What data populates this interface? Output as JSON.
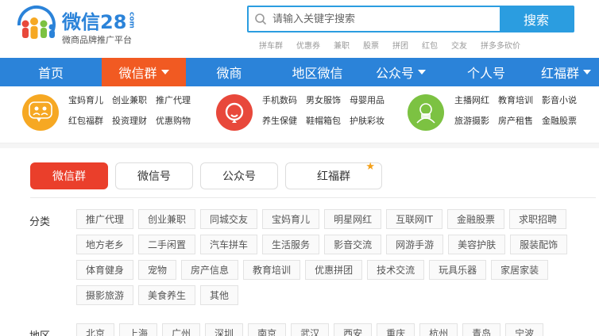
{
  "logo": {
    "name": "微信28",
    "suffix": "com",
    "tagline": "微商品牌推广平台",
    "color": "#2b83d9"
  },
  "search": {
    "placeholder": "请输入关键字搜索",
    "button_label": "搜索",
    "hotwords": [
      "拼车群",
      "优惠券",
      "兼职",
      "股票",
      "拼团",
      "红包",
      "交友",
      "拼多多砍价"
    ]
  },
  "nav": {
    "items": [
      {
        "label": "首页",
        "dropdown": false,
        "active": false
      },
      {
        "label": "微信群",
        "dropdown": true,
        "active": true
      },
      {
        "label": "微商",
        "dropdown": false,
        "active": false
      },
      {
        "label": "地区微信",
        "dropdown": false,
        "active": false
      },
      {
        "label": "公众号",
        "dropdown": true,
        "active": false
      },
      {
        "label": "个人号",
        "dropdown": false,
        "active": false
      },
      {
        "label": "红福群",
        "dropdown": true,
        "active": false
      }
    ],
    "bg_color": "#2b83d9",
    "active_color": "#f15a22"
  },
  "quick": {
    "groups": [
      {
        "icon_label": "微信群",
        "icon_color": "#f6a823",
        "links": [
          "宝妈育儿",
          "创业兼职",
          "推广代理",
          "红包福群",
          "投资理财",
          "优惠购物"
        ]
      },
      {
        "icon_label": "",
        "icon_color": "#e8483b",
        "links": [
          "手机数码",
          "男女服饰",
          "母婴用品",
          "养生保健",
          "鞋帽箱包",
          "护肤彩妆"
        ]
      },
      {
        "icon_label": "微信",
        "icon_color": "#7cc242",
        "links": [
          "主播网红",
          "教育培训",
          "影音小说",
          "旅游摄影",
          "房产租售",
          "金融股票"
        ]
      }
    ]
  },
  "tabs": [
    {
      "label": "微信群",
      "active": true,
      "star": false
    },
    {
      "label": "微信号",
      "active": false,
      "star": false
    },
    {
      "label": "公众号",
      "active": false,
      "star": false
    },
    {
      "label": "红福群",
      "active": false,
      "star": true
    }
  ],
  "filters": {
    "category": {
      "label": "分类",
      "tags": [
        "推广代理",
        "创业兼职",
        "同城交友",
        "宝妈育儿",
        "明星网红",
        "互联网IT",
        "金融股票",
        "求职招聘",
        "地方老乡",
        "二手闲置",
        "汽车拼车",
        "生活服务",
        "影音交流",
        "网游手游",
        "美容护肤",
        "服装配饰",
        "体育健身",
        "宠物",
        "房产信息",
        "教育培训",
        "优惠拼团",
        "技术交流",
        "玩具乐器",
        "家居家装",
        "摄影旅游",
        "美食养生",
        "其他"
      ]
    },
    "region": {
      "label": "地区",
      "tags": [
        "北京",
        "上海",
        "广州",
        "深圳",
        "南京",
        "武汉",
        "西安",
        "重庆",
        "杭州",
        "青岛",
        "宁波"
      ]
    }
  }
}
